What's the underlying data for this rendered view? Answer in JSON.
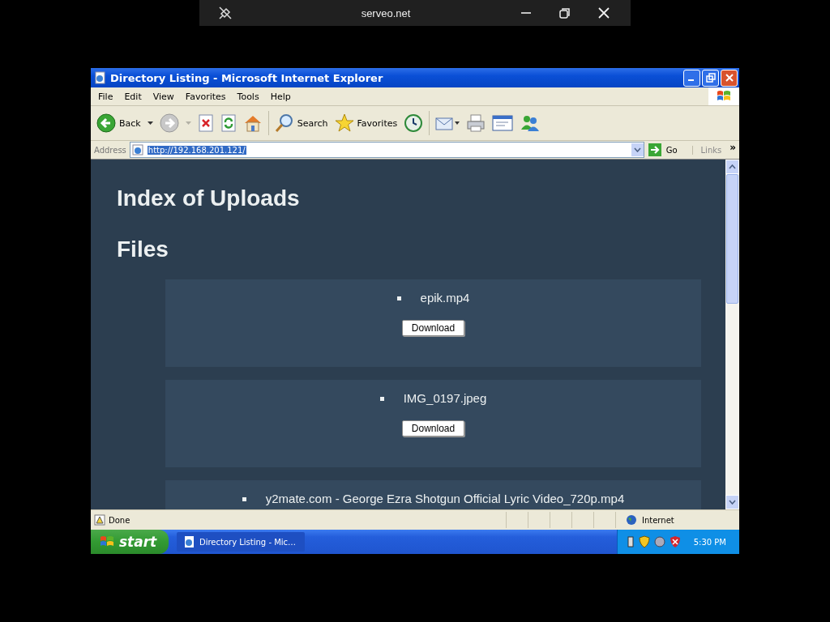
{
  "viewer": {
    "title": "serveo.net"
  },
  "window": {
    "title": "Directory Listing - Microsoft Internet Explorer"
  },
  "menu": [
    "File",
    "Edit",
    "View",
    "Favorites",
    "Tools",
    "Help"
  ],
  "toolbar": [
    {
      "kind": "back",
      "label": "Back"
    },
    {
      "kind": "forward"
    },
    {
      "kind": "stop"
    },
    {
      "kind": "refresh"
    },
    {
      "kind": "home"
    },
    {
      "kind": "search",
      "label": "Search"
    },
    {
      "kind": "favorites",
      "label": "Favorites"
    },
    {
      "kind": "history"
    },
    {
      "kind": "mail"
    },
    {
      "kind": "print"
    },
    {
      "kind": "edit"
    },
    {
      "kind": "messenger"
    }
  ],
  "address": {
    "label": "Address",
    "value": "http://192.168.201.121/",
    "selected": true,
    "go": "Go",
    "links": "Links",
    "more": "»"
  },
  "page": {
    "title": "Index of Uploads",
    "section": "Files",
    "files": [
      {
        "name": "epik.mp4",
        "button": "Download"
      },
      {
        "name": "IMG_0197.jpeg",
        "button": "Download"
      },
      {
        "name": "y2mate.com - George Ezra Shotgun Official Lyric Video_720p.mp4"
      }
    ]
  },
  "status": {
    "text": "Done",
    "zone": "Internet"
  },
  "taskbar": {
    "start": "start",
    "task": "Directory Listing - Mic…",
    "time": "5:30 PM"
  }
}
